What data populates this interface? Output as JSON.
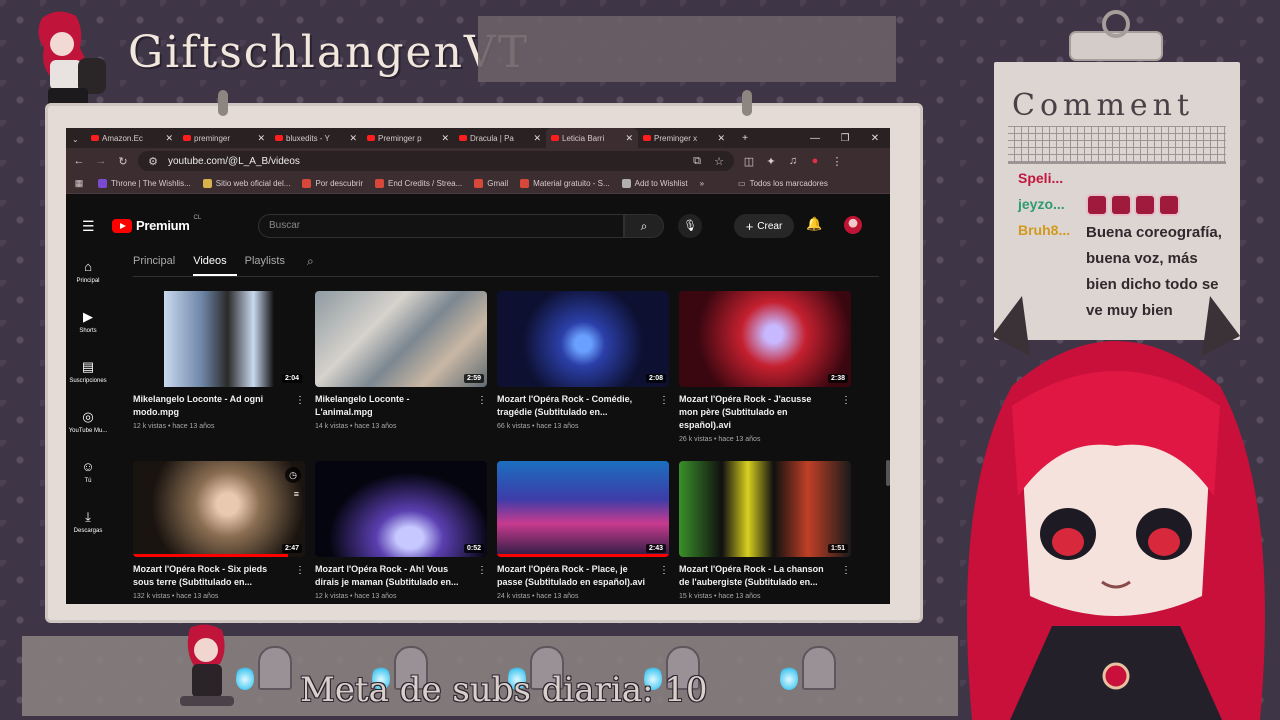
{
  "overlay": {
    "channel_name": "GiftschlangenVT",
    "sub_goal": "Meta de subs diaria: 10"
  },
  "browser": {
    "tabs": [
      {
        "label": "Amazon.Ec",
        "active": false
      },
      {
        "label": "preminger",
        "active": false
      },
      {
        "label": "bluxedits - Y",
        "active": false
      },
      {
        "label": "Preminger p",
        "active": false
      },
      {
        "label": "Dracula | Pa",
        "active": false
      },
      {
        "label": "Leticia Barri",
        "active": true
      },
      {
        "label": "Preminger x",
        "active": false
      }
    ],
    "new_tab": "+",
    "url": "youtube.com/@L_A_B/videos",
    "bookmarks": [
      {
        "label": "Throne | The Wishlis...",
        "color": "#7a4ad0"
      },
      {
        "label": "Sitio web oficial del...",
        "color": "#d8b24a"
      },
      {
        "label": "Por descubrir",
        "color": "#d8483a"
      },
      {
        "label": "End Credits / Strea...",
        "color": "#d8483a"
      },
      {
        "label": "Gmail",
        "color": "#d8483a"
      },
      {
        "label": "Material gratuito - S...",
        "color": "#d8483a"
      },
      {
        "label": "Add to Wishlist",
        "color": "#b0b0b0"
      }
    ],
    "bookmarks_overflow": "»",
    "all_bookmarks": "Todos los marcadores"
  },
  "youtube": {
    "logo_text": "Premium",
    "region": "CL",
    "search_placeholder": "Buscar",
    "create_label": "Crear",
    "sidebar": [
      {
        "icon": "home-icon",
        "glyph": "⌂",
        "label": "Principal"
      },
      {
        "icon": "shorts-icon",
        "glyph": "▶",
        "label": "Shorts"
      },
      {
        "icon": "subscriptions-icon",
        "glyph": "▤",
        "label": "Suscripciones"
      },
      {
        "icon": "youtube-music-icon",
        "glyph": "◎",
        "label": "YouTube Mu..."
      },
      {
        "icon": "you-icon",
        "glyph": "☺",
        "label": "Tú"
      },
      {
        "icon": "downloads-icon",
        "glyph": "⤓",
        "label": "Descargas"
      }
    ],
    "channel_tabs": [
      {
        "label": "Principal",
        "active": false
      },
      {
        "label": "Videos",
        "active": true
      },
      {
        "label": "Playlists",
        "active": false
      }
    ],
    "videos": [
      {
        "title": "Mikelangelo Loconte - Ad ogni modo.mpg",
        "meta": "12 k vistas • hace 13 años",
        "duration": "2:04",
        "thumb": "linear-gradient(90deg,#0f0f0f 18%,#c9d9ef 18%,#6f86a8 40%,#2a2a2a 55%,#c9d9ef 70%,#0f0f0f 82%)"
      },
      {
        "title": "Mikelangelo Loconte - L'animal.mpg",
        "meta": "14 k vistas • hace 13 años",
        "duration": "2:59",
        "thumb": "linear-gradient(135deg,#8e9aa2,#d6d2cc 35%,#7c8790 55%,#c9b7a4 75%,#5e6a72)"
      },
      {
        "title": "Mozart l'Opéra Rock - Comédie, tragédie (Subtitulado en...",
        "meta": "66 k vistas • hace 13 años",
        "duration": "2:08",
        "thumb": "radial-gradient(circle at 50% 55%,#6aa0ff 8%,#2b3fa8 22%,#0d1030 60%)"
      },
      {
        "title": "Mozart l'Opéra Rock - J'acusse mon père (Subtitulado en español).avi",
        "meta": "26 k vistas • hace 13 años",
        "duration": "2:38",
        "thumb": "radial-gradient(circle at 55% 45%,#c7b8ff 8%,#c4202f 30%,#3a0710 70%)"
      },
      {
        "title": "Mozart l'Opéra Rock - Six pieds sous terre (Subtitulado en...",
        "meta": "132 k vistas • hace 13 años",
        "duration": "2:47",
        "thumb": "radial-gradient(circle at 55% 45%,#e9c9b0 10%,#8a6e52 30%,#1a1410 70%)",
        "progress": 0.9,
        "hover": true
      },
      {
        "title": "Mozart l'Opéra Rock - Ah! Vous dirais je maman (Subtitulado en...",
        "meta": "12 k vistas • hace 13 años",
        "duration": "0:52",
        "thumb": "radial-gradient(ellipse at 55% 80%,#c6c8ff 10%,#5a3fb0 25%,#050510 60%)"
      },
      {
        "title": "Mozart l'Opéra Rock - Place, je passe (Subtitulado en español).avi",
        "meta": "24 k vistas • hace 13 años",
        "duration": "2:43",
        "thumb": "linear-gradient(180deg,#1b6fbf,#3d3ca8 40%,#c83b8f 65%,#2a1c40)",
        "progress": 1.0
      },
      {
        "title": "Mozart l'Opéra Rock - La chanson de l'aubergiste (Subtitulado en...",
        "meta": "15 k vistas • hace 13 años",
        "duration": "1:51",
        "thumb": "linear-gradient(90deg,#3a8f2a,#101010 25%,#d8d020 40%,#101010 55%,#c04026 75%,#1a1a1a)"
      }
    ]
  },
  "chat": {
    "title": "Comment",
    "entries": [
      {
        "name": "Speli...",
        "color": "#c1173f"
      },
      {
        "name": "jeyzo...",
        "color": "#2d9b73"
      },
      {
        "name": "Bruh8...",
        "color": "#d19a1e"
      }
    ],
    "message": "Buena coreografía, buena voz, más bien dicho todo se ve muy bien"
  }
}
